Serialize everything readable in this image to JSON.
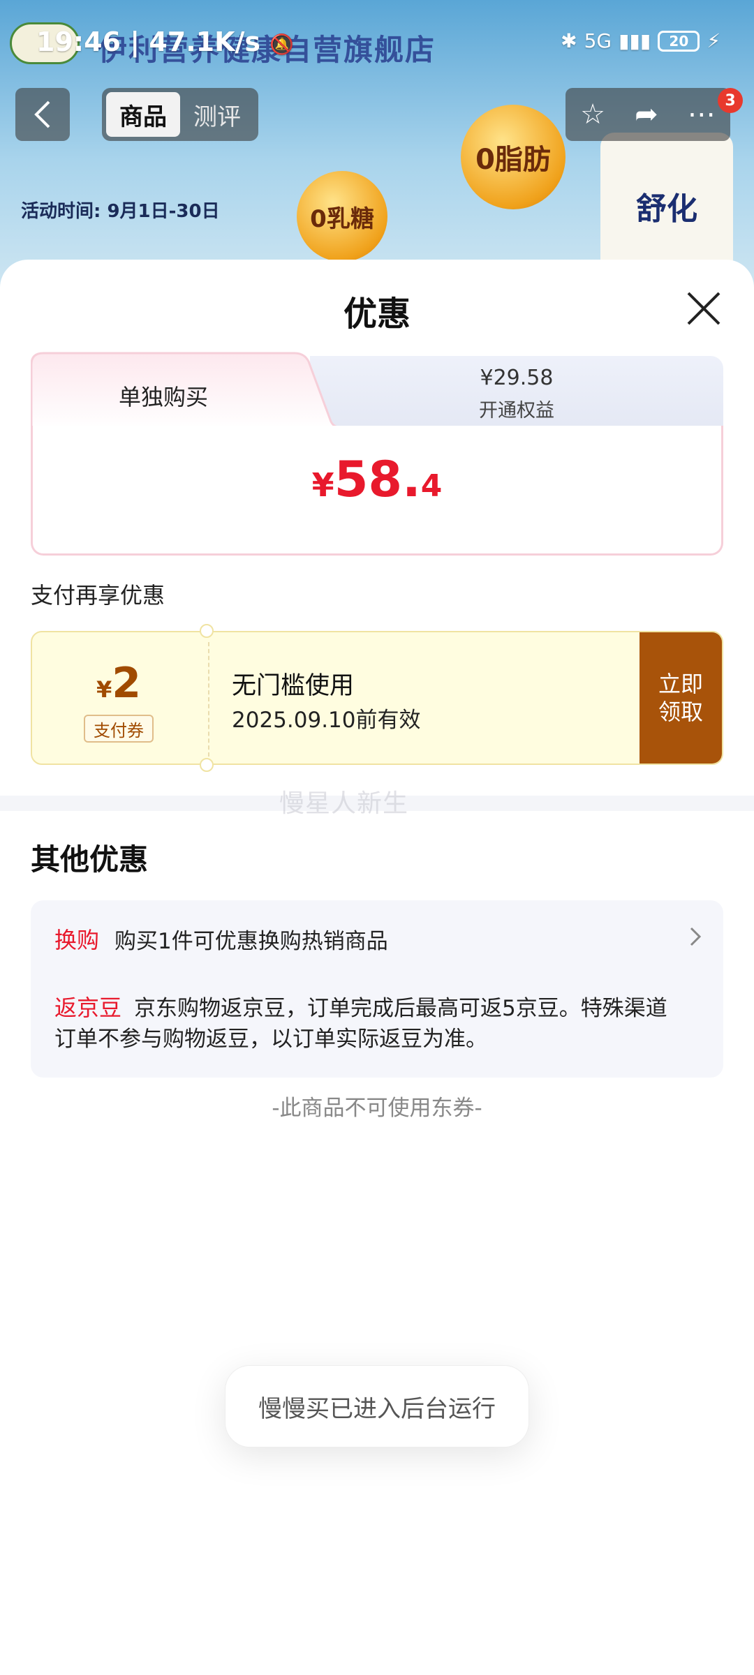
{
  "status_bar": {
    "time": "19:46",
    "network_speed": "47.1K/s",
    "signal": "5G",
    "battery": "20"
  },
  "background_page": {
    "shop_title": "伊利营养健康自营旗舰店",
    "tabs": [
      {
        "label": "商品",
        "active": true
      },
      {
        "label": "测评",
        "active": false
      }
    ],
    "cart_badge": "3",
    "activity_text": "活动时间: 9月1日-30日",
    "badge_fat": "0脂肪",
    "badge_lactose": "0乳糖",
    "brand_text": "舒化"
  },
  "sheet": {
    "title": "优惠",
    "price_tabs": {
      "active_label": "单独购买",
      "inactive_price": "¥29.58",
      "inactive_label": "开通权益"
    },
    "price": {
      "symbol": "¥",
      "integer": "58.",
      "decimal": "4"
    },
    "pay_section_title": "支付再享优惠",
    "coupon": {
      "symbol": "¥",
      "amount": "2",
      "type": "支付券",
      "condition": "无门槛使用",
      "validity": "2025.09.10前有效",
      "claim_line1": "立即",
      "claim_line2": "领取"
    },
    "watermark": "慢星人新生",
    "other_title": "其他优惠",
    "promos": [
      {
        "tag": "换购",
        "text": "购买1件可优惠换购热销商品"
      },
      {
        "tag": "返京豆",
        "text": "京东购物返京豆，订单完成后最高可返5京豆。特殊渠道订单不参与购物返豆，以订单实际返豆为准。"
      }
    ],
    "no_coupon_note": "-此商品不可使用东券-"
  },
  "toast": {
    "text": "慢慢买已进入后台运行"
  },
  "colors": {
    "price_red": "#e8192c",
    "coupon_brown": "#a8530a",
    "coupon_bg": "#fffde0"
  }
}
